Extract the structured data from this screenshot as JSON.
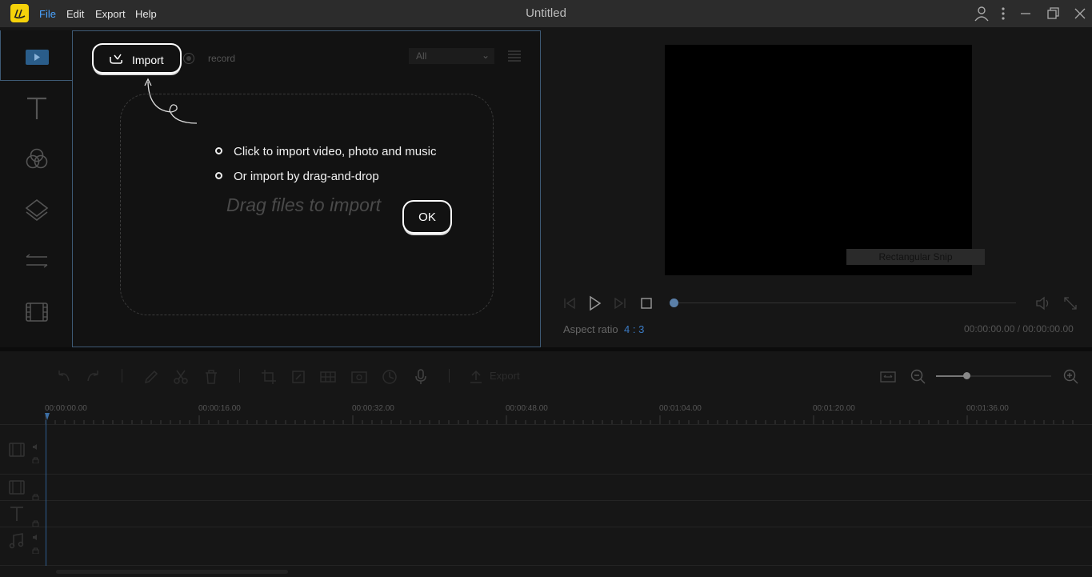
{
  "window": {
    "title": "Untitled",
    "menu": [
      "File",
      "Edit",
      "Export",
      "Help"
    ],
    "controls": [
      "user-icon",
      "more-vertical-icon",
      "minimize-icon",
      "restore-icon",
      "close-icon"
    ]
  },
  "sidebar": {
    "items": [
      "media-icon",
      "text-icon",
      "filter-icon",
      "overlay-icon",
      "transition-icon",
      "film-icon"
    ]
  },
  "media": {
    "import_label": "Import",
    "record_label": "record",
    "filter_value": "All",
    "tips": [
      "Click to import video, photo and music",
      "Or import by drag-and-drop"
    ],
    "drag_text": "Drag files to import",
    "ok_label": "OK"
  },
  "preview": {
    "snip_label": "Rectangular Snip",
    "aspect_label": "Aspect ratio",
    "aspect_value": "4 : 3",
    "time_readout": "00:00:00.00 / 00:00:00.00",
    "progress": 0
  },
  "toolbar": {
    "export_label": "Export",
    "zoom_fraction": 0.27
  },
  "ruler": {
    "labels": [
      "00:00:00.00",
      "00:00:16.00",
      "00:00:32.00",
      "00:00:48.00",
      "00:01:04.00",
      "00:01:20.00",
      "00:01:36.00"
    ]
  },
  "tracks": [
    "video-track",
    "overlay-track",
    "text-track",
    "music-track"
  ],
  "colors": {
    "accent": "#4aa3ff",
    "logo": "#f5d20a",
    "border": "#3e5a75"
  }
}
